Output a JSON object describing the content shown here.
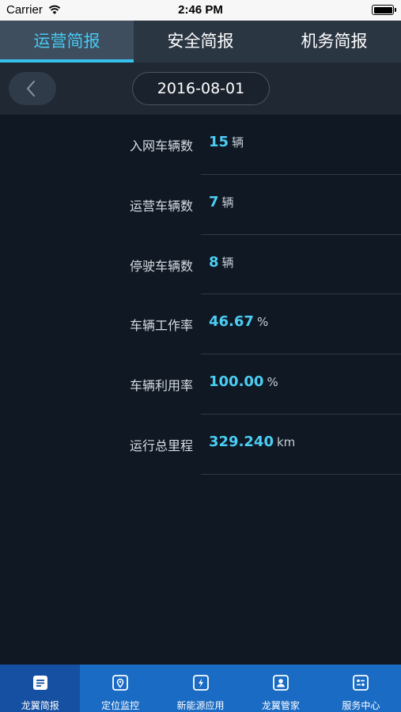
{
  "status_bar": {
    "carrier": "Carrier",
    "time": "2:46 PM"
  },
  "top_tabs": [
    {
      "label": "运营简报",
      "active": true
    },
    {
      "label": "安全简报",
      "active": false
    },
    {
      "label": "机务简报",
      "active": false
    }
  ],
  "date_bar": {
    "date": "2016-08-01",
    "back_icon": "chevron-left-icon"
  },
  "stats": [
    {
      "label": "入网车辆数",
      "value": "15",
      "unit": "辆"
    },
    {
      "label": "运营车辆数",
      "value": "7",
      "unit": "辆"
    },
    {
      "label": "停驶车辆数",
      "value": "8",
      "unit": "辆"
    },
    {
      "label": "车辆工作率",
      "value": "46.67",
      "unit": "%"
    },
    {
      "label": "车辆利用率",
      "value": "100.00",
      "unit": "%"
    },
    {
      "label": "运行总里程",
      "value": "329.240",
      "unit": "km"
    }
  ],
  "bottom_tabs": [
    {
      "label": "龙翼简报",
      "icon": "document-icon",
      "active": true
    },
    {
      "label": "定位监控",
      "icon": "location-pin-icon",
      "active": false
    },
    {
      "label": "新能源应用",
      "icon": "lightning-icon",
      "active": false
    },
    {
      "label": "龙翼管家",
      "icon": "person-card-icon",
      "active": false
    },
    {
      "label": "服务中心",
      "icon": "settings-panel-icon",
      "active": false
    }
  ],
  "colors": {
    "accent": "#4ccdf3",
    "background": "#0f1823",
    "tab_bar": "#2b3643",
    "bottom_bar": "#1a6bc4",
    "bottom_bar_active": "#1650a2"
  }
}
